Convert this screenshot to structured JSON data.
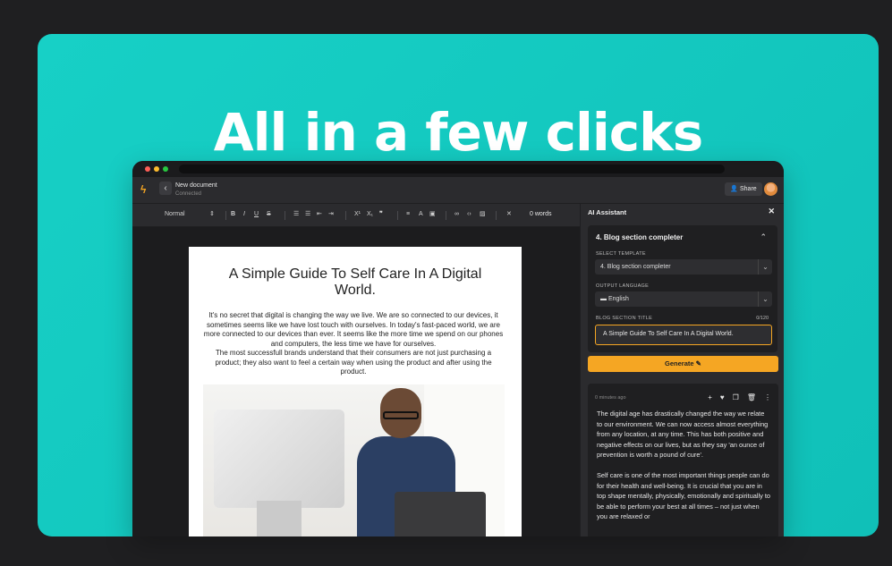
{
  "hero": {
    "headline": "All in a few clicks"
  },
  "colors": {
    "brand": "#15c9c0",
    "accent": "#f5a623"
  },
  "app": {
    "document_name": "New document",
    "document_status": "Connected",
    "share_label": "Share",
    "icons": [
      "logo-icon",
      "back-icon",
      "share-user-icon",
      "avatar"
    ]
  },
  "toolbar": {
    "style_select": "Normal",
    "word_count": "0 words",
    "bold": "B",
    "italic": "I",
    "underline": "U",
    "strike": "S",
    "superscript": "X¹",
    "subscript": "X₁",
    "quote": "❞"
  },
  "document": {
    "title": "A Simple Guide To Self Care In A Digital World.",
    "paragraph1": "It's no secret that digital is changing the way we live. We are so connected to our devices, it sometimes seems like we have lost touch with ourselves. In today's fast-paced world, we are more connected to our devices than ever. It seems like the more time we spend on our phones and computers, the less time we have for ourselves.",
    "paragraph2": "The most successfull brands understand that their consumers are not just purchasing a product; they also want to feel a certain way when using the product and after using the product."
  },
  "ai": {
    "header": "AI Assistant",
    "template_title": "4. Blog section completer",
    "select_template_label": "SELECT TEMPLATE",
    "select_template_value": "4. Blog section completer",
    "output_language_label": "OUTPUT LANGUAGE",
    "output_language_value": "English",
    "section_title_label": "BLOG SECTION TITLE",
    "section_title_counter": "0/120",
    "section_title_value": "A Simple Guide To Self Care In A Digital World.",
    "generate_label": "Generate",
    "result": {
      "time": "0 minutes ago",
      "paragraph1": "The digital age has drastically changed the way we relate to our environment. We can now access almost everything from any location, at any time. This has both positive and negative effects on our lives, but as they say 'an ounce of prevention is worth a pound of cure'.",
      "paragraph2": "Self care is one of the most important things people can do for their health and well-being. It is crucial that you are in top shape mentally, physically, emotionally and spiritually to be able to perform your best at all times – not just when you are relaxed or"
    }
  }
}
